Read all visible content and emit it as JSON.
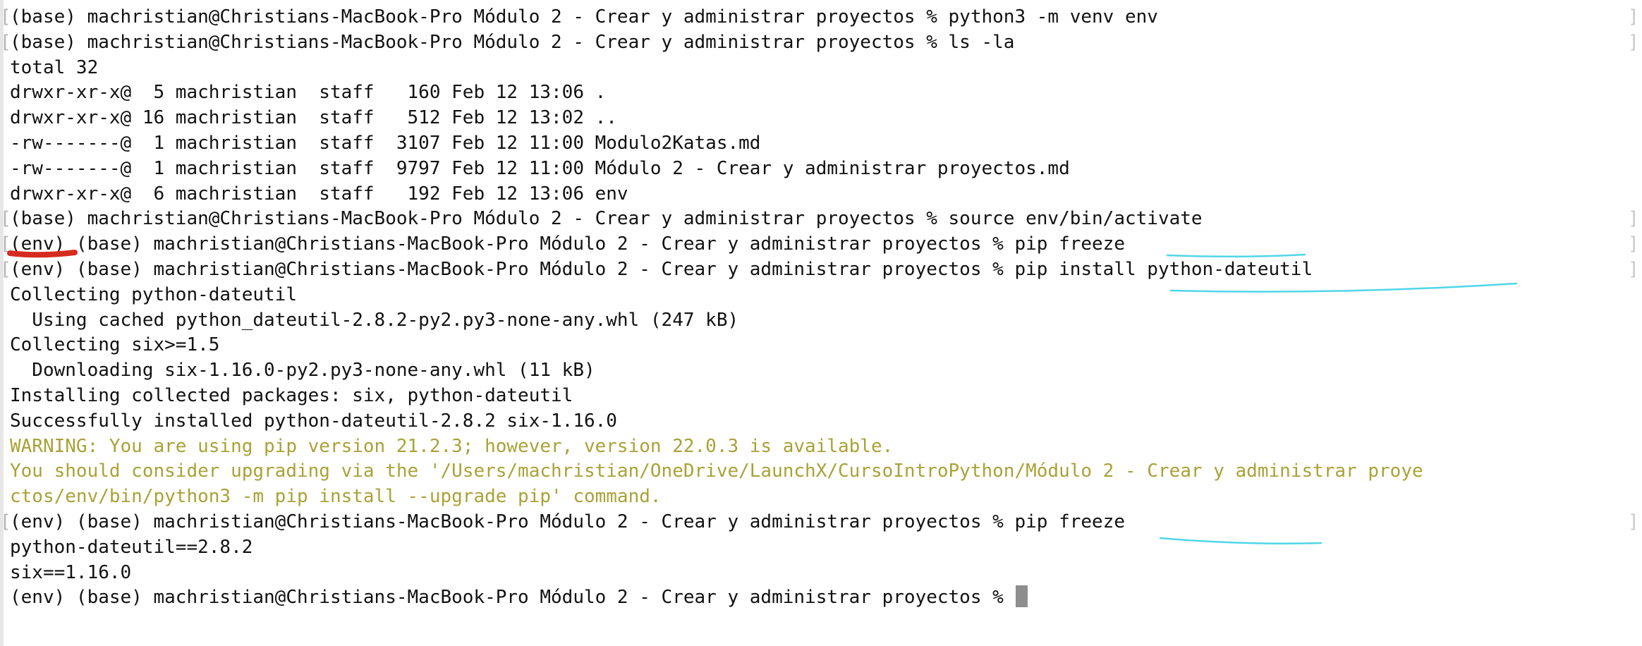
{
  "terminal": {
    "lines": [
      {
        "text": "(base) machristian@Christians-MacBook-Pro Módulo 2 - Crear y administrar proyectos % python3 -m venv env",
        "prompt": true
      },
      {
        "text": "(base) machristian@Christians-MacBook-Pro Módulo 2 - Crear y administrar proyectos % ls -la",
        "prompt": true
      },
      {
        "text": "total 32",
        "prompt": false
      },
      {
        "text": "drwxr-xr-x@  5 machristian  staff   160 Feb 12 13:06 .",
        "prompt": false
      },
      {
        "text": "drwxr-xr-x@ 16 machristian  staff   512 Feb 12 13:02 ..",
        "prompt": false
      },
      {
        "text": "-rw-------@  1 machristian  staff  3107 Feb 12 11:00 Modulo2Katas.md",
        "prompt": false
      },
      {
        "text": "-rw-------@  1 machristian  staff  9797 Feb 12 11:00 Módulo 2 - Crear y administrar proyectos.md",
        "prompt": false
      },
      {
        "text": "drwxr-xr-x@  6 machristian  staff   192 Feb 12 13:06 env",
        "prompt": false
      },
      {
        "text": "(base) machristian@Christians-MacBook-Pro Módulo 2 - Crear y administrar proyectos % source env/bin/activate",
        "prompt": true
      },
      {
        "text": "(env) (base) machristian@Christians-MacBook-Pro Módulo 2 - Crear y administrar proyectos % pip freeze",
        "prompt": true
      },
      {
        "text": "(env) (base) machristian@Christians-MacBook-Pro Módulo 2 - Crear y administrar proyectos % pip install python-dateutil",
        "prompt": true
      },
      {
        "text": "Collecting python-dateutil",
        "prompt": false
      },
      {
        "text": "  Using cached python_dateutil-2.8.2-py2.py3-none-any.whl (247 kB)",
        "prompt": false
      },
      {
        "text": "Collecting six>=1.5",
        "prompt": false
      },
      {
        "text": "  Downloading six-1.16.0-py2.py3-none-any.whl (11 kB)",
        "prompt": false
      },
      {
        "text": "Installing collected packages: six, python-dateutil",
        "prompt": false
      },
      {
        "text": "Successfully installed python-dateutil-2.8.2 six-1.16.0",
        "prompt": false
      },
      {
        "text": "WARNING: You are using pip version 21.2.3; however, version 22.0.3 is available.",
        "prompt": false,
        "warn": true
      },
      {
        "text": "You should consider upgrading via the '/Users/machristian/OneDrive/LaunchX/CursoIntroPython/Módulo 2 - Crear y administrar proye",
        "prompt": false,
        "warn": true
      },
      {
        "text": "ctos/env/bin/python3 -m pip install --upgrade pip' command.",
        "prompt": false,
        "warn": true
      },
      {
        "text": "(env) (base) machristian@Christians-MacBook-Pro Módulo 2 - Crear y administrar proyectos % pip freeze",
        "prompt": true
      },
      {
        "text": "python-dateutil==2.8.2",
        "prompt": false
      },
      {
        "text": "six==1.16.0",
        "prompt": false
      },
      {
        "text": "(env) (base) machristian@Christians-MacBook-Pro Módulo 2 - Crear y administrar proyectos % ",
        "prompt": false,
        "cursor": true
      }
    ],
    "colors": {
      "background": "#ffffff",
      "text": "#111111",
      "warning": "#a9a236",
      "underline_red": "#d62b1f",
      "underline_cyan": "#4fd6e8",
      "cursor": "#8e8e8e"
    }
  }
}
